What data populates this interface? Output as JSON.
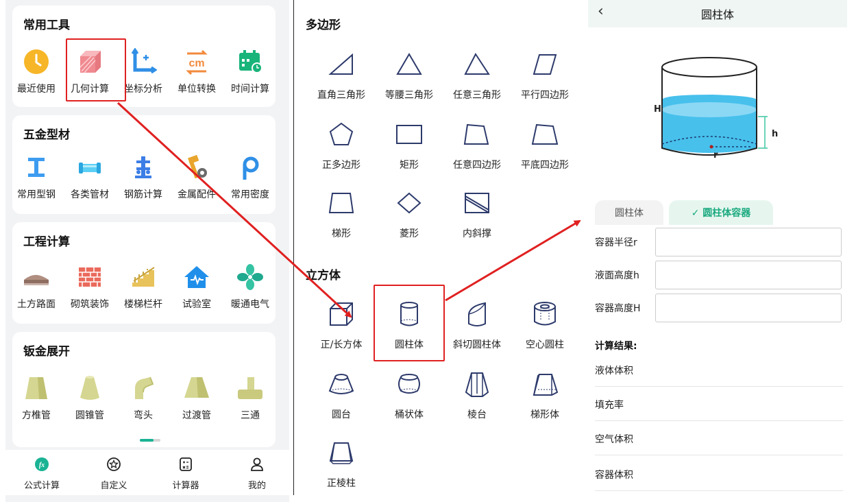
{
  "panel1": {
    "sections": [
      {
        "title": "常用工具",
        "items": [
          {
            "label": "最近使用",
            "icon": "clock-icon"
          },
          {
            "label": "几何计算",
            "icon": "cube-icon"
          },
          {
            "label": "坐标分析",
            "icon": "axis-icon"
          },
          {
            "label": "单位转换",
            "icon": "cm-icon"
          },
          {
            "label": "时间计算",
            "icon": "calendar-icon"
          }
        ]
      },
      {
        "title": "五金型材",
        "items": [
          {
            "label": "常用型钢",
            "icon": "i-beam-icon"
          },
          {
            "label": "各类管材",
            "icon": "pipe-icon"
          },
          {
            "label": "钢筋计算",
            "icon": "rebar-icon"
          },
          {
            "label": "金属配件",
            "icon": "hammer-icon"
          },
          {
            "label": "常用密度",
            "icon": "rho-icon"
          }
        ]
      },
      {
        "title": "工程计算",
        "items": [
          {
            "label": "土方路面",
            "icon": "road-icon"
          },
          {
            "label": "砌筑装饰",
            "icon": "brick-icon"
          },
          {
            "label": "楼梯栏杆",
            "icon": "stairs-icon"
          },
          {
            "label": "试验室",
            "icon": "lab-house-icon"
          },
          {
            "label": "暖通电气",
            "icon": "fan-icon"
          }
        ]
      },
      {
        "title": "钣金展开",
        "items": [
          {
            "label": "方椎管",
            "icon": "square-cone-icon"
          },
          {
            "label": "圆锥管",
            "icon": "cone-icon"
          },
          {
            "label": "弯头",
            "icon": "elbow-icon"
          },
          {
            "label": "过渡管",
            "icon": "transition-icon"
          },
          {
            "label": "三通",
            "icon": "tee-icon"
          }
        ]
      }
    ],
    "tabbar": [
      {
        "label": "公式计算",
        "icon": "fx-icon"
      },
      {
        "label": "自定义",
        "icon": "star-circle-icon"
      },
      {
        "label": "计算器",
        "icon": "calculator-icon"
      },
      {
        "label": "我的",
        "icon": "user-icon"
      }
    ]
  },
  "panel2": {
    "polygon_title": "多边形",
    "polygons": [
      "直角三角形",
      "等腰三角形",
      "任意三角形",
      "平行四边形",
      "正多边形",
      "矩形",
      "任意四边形",
      "平底四边形",
      "梯形",
      "菱形",
      "内斜撑"
    ],
    "solid_title": "立方体",
    "solids": [
      "正/长方体",
      "圆柱体",
      "斜切圆柱体",
      "空心圆柱",
      "圆台",
      "桶状体",
      "棱台",
      "梯形体",
      "正棱柱"
    ]
  },
  "panel3": {
    "title": "圆柱体",
    "back_icon": "chevron-left-icon",
    "diagram_labels": {
      "H": "H",
      "h": "h",
      "r": "r"
    },
    "tabs": {
      "off": "圆柱体",
      "on": "✓ 圆柱体容器"
    },
    "fields": [
      {
        "label": "容器半径r",
        "value": ""
      },
      {
        "label": "液面高度h",
        "value": ""
      },
      {
        "label": "容器高度H",
        "value": ""
      }
    ],
    "result_title": "计算结果:",
    "results": [
      "液体体积",
      "填充率",
      "空气体积",
      "容器体积"
    ]
  },
  "colors": {
    "accent": "#1ab394",
    "highlight": "#e02020",
    "shape_stroke": "#2d3a6b",
    "water": "#3fbbe8"
  }
}
